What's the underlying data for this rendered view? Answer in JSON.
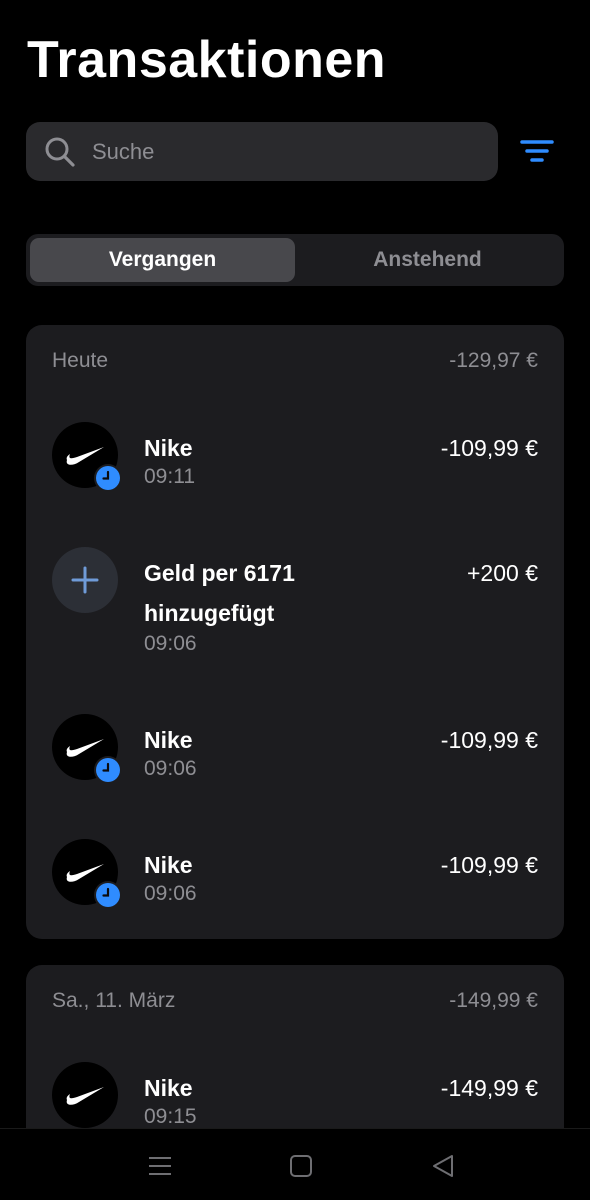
{
  "page": {
    "title": "Transaktionen"
  },
  "search": {
    "placeholder": "Suche"
  },
  "tabs": [
    {
      "label": "Vergangen",
      "active": true
    },
    {
      "label": "Anstehend",
      "active": false
    }
  ],
  "groups": [
    {
      "date": "Heute",
      "total": "-129,97 €",
      "transactions": [
        {
          "merchant": "Nike",
          "time": "09:11",
          "amount": "-109,99 €",
          "icon": "nike-swoosh-icon",
          "pending": true
        },
        {
          "merchant": "Geld per 6171 hinzugefügt",
          "time": "09:06",
          "amount": "+200 €",
          "icon": "plus-icon",
          "pending": false
        },
        {
          "merchant": "Nike",
          "time": "09:06",
          "amount": "-109,99 €",
          "icon": "nike-swoosh-icon",
          "pending": true
        },
        {
          "merchant": "Nike",
          "time": "09:06",
          "amount": "-109,99 €",
          "icon": "nike-swoosh-icon",
          "pending": true
        }
      ]
    },
    {
      "date": "Sa., 11. März",
      "total": "-149,99 €",
      "transactions": [
        {
          "merchant": "Nike",
          "time": "09:15",
          "amount": "-149,99 €",
          "icon": "nike-swoosh-icon",
          "pending": false
        }
      ]
    }
  ],
  "colors": {
    "accent": "#2f8cff",
    "card": "#1c1c1f",
    "muted": "#8e8e93"
  },
  "navbar": {
    "icons": [
      "menu-icon",
      "home-icon",
      "back-icon"
    ]
  }
}
